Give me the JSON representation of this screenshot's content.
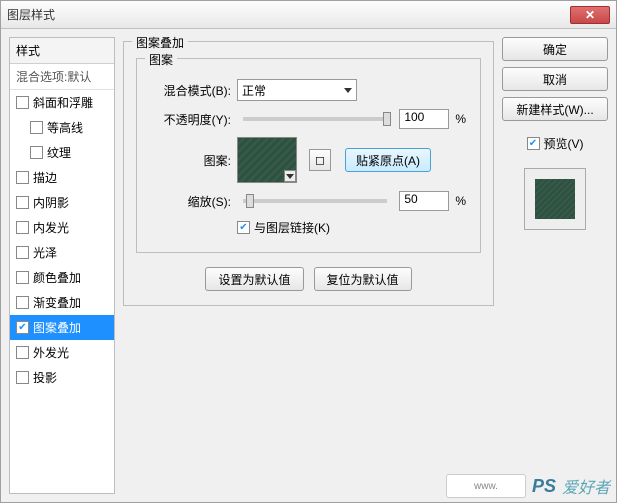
{
  "title": "图层样式",
  "styles_panel": {
    "header": "样式",
    "subheader": "混合选项:默认",
    "items": [
      {
        "label": "斜面和浮雕",
        "checked": false,
        "indent": false
      },
      {
        "label": "等高线",
        "checked": false,
        "indent": true
      },
      {
        "label": "纹理",
        "checked": false,
        "indent": true
      },
      {
        "label": "描边",
        "checked": false,
        "indent": false
      },
      {
        "label": "内阴影",
        "checked": false,
        "indent": false
      },
      {
        "label": "内发光",
        "checked": false,
        "indent": false
      },
      {
        "label": "光泽",
        "checked": false,
        "indent": false
      },
      {
        "label": "颜色叠加",
        "checked": false,
        "indent": false
      },
      {
        "label": "渐变叠加",
        "checked": false,
        "indent": false
      },
      {
        "label": "图案叠加",
        "checked": true,
        "indent": false,
        "selected": true
      },
      {
        "label": "外发光",
        "checked": false,
        "indent": false
      },
      {
        "label": "投影",
        "checked": false,
        "indent": false
      }
    ]
  },
  "center": {
    "section_title": "图案叠加",
    "group_title": "图案",
    "blend_mode_label": "混合模式(B):",
    "blend_mode_value": "正常",
    "opacity_label": "不透明度(Y):",
    "opacity_value": "100",
    "percent": "%",
    "pattern_label": "图案:",
    "snap_label": "贴紧原点(A)",
    "scale_label": "缩放(S):",
    "scale_value": "50",
    "link_label": "与图层链接(K)",
    "set_default": "设置为默认值",
    "reset_default": "复位为默认值"
  },
  "right": {
    "ok": "确定",
    "cancel": "取消",
    "new_style": "新建样式(W)...",
    "preview_label": "预览(V)"
  },
  "watermark": {
    "url": "www.",
    "ps": "PS",
    "text": "爱好者"
  }
}
